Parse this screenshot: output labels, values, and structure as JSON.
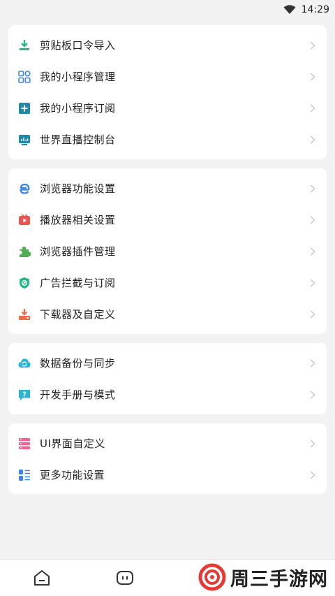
{
  "status_bar": {
    "time": "14:29"
  },
  "groups": [
    {
      "items": [
        {
          "label": "剪贴板口令导入",
          "icon": "import-icon"
        },
        {
          "label": "我的小程序管理",
          "icon": "apps-grid-icon"
        },
        {
          "label": "我的小程序订阅",
          "icon": "subscribe-plus-icon"
        },
        {
          "label": "世界直播控制台",
          "icon": "live-console-icon"
        }
      ]
    },
    {
      "items": [
        {
          "label": "浏览器功能设置",
          "icon": "browser-e-icon"
        },
        {
          "label": "播放器相关设置",
          "icon": "player-icon"
        },
        {
          "label": "浏览器插件管理",
          "icon": "puzzle-icon"
        },
        {
          "label": "广告拦截与订阅",
          "icon": "shield-block-icon"
        },
        {
          "label": "下载器及自定义",
          "icon": "download-icon"
        }
      ]
    },
    {
      "items": [
        {
          "label": "数据备份与同步",
          "icon": "cloud-sync-icon"
        },
        {
          "label": "开发手册与模式",
          "icon": "help-icon"
        }
      ]
    },
    {
      "items": [
        {
          "label": "UI界面自定义",
          "icon": "ui-layout-icon"
        },
        {
          "label": "更多功能设置",
          "icon": "list-settings-icon"
        }
      ]
    }
  ],
  "bottom_nav": {
    "home": "home-icon",
    "tab2": "tabs-icon"
  },
  "watermark": {
    "text": "周三手游网"
  },
  "colors": {
    "green": "#27b887",
    "blue": "#3a86e8",
    "red": "#ef5350",
    "orange": "#f06a43",
    "cyan": "#29b6d6",
    "pink": "#f06292"
  }
}
